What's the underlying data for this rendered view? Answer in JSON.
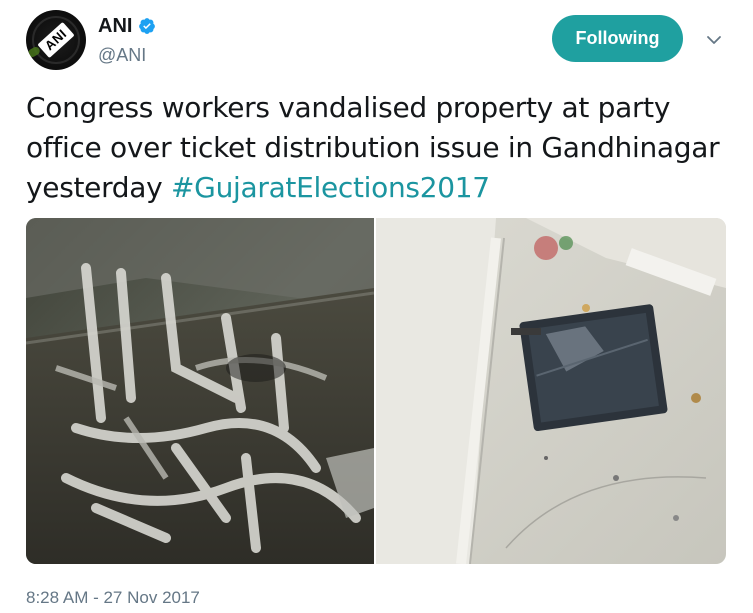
{
  "account": {
    "name": "ANI",
    "handle": "@ANI",
    "avatar_text": "ANI",
    "verified": true
  },
  "follow_button": {
    "label": "Following"
  },
  "tweet": {
    "text": "Congress workers vandalised property at party office over ticket distribution issue in Gandhinagar yesterday ",
    "hashtag": "#GujaratElections2017",
    "timestamp": "8:28 AM - 27 Nov 2017"
  },
  "media": {
    "photos": [
      {
        "subject": "broken-white-plastic-chairs"
      },
      {
        "subject": "smashed-laptop-on-floor"
      }
    ]
  },
  "colors": {
    "accent": "#1fa0a0",
    "hashtag": "#1b95a0",
    "verified": "#1da1f2",
    "secondary_text": "#657786"
  },
  "icons": {
    "verified": "verified-badge-icon",
    "menu": "chevron-down-icon"
  }
}
